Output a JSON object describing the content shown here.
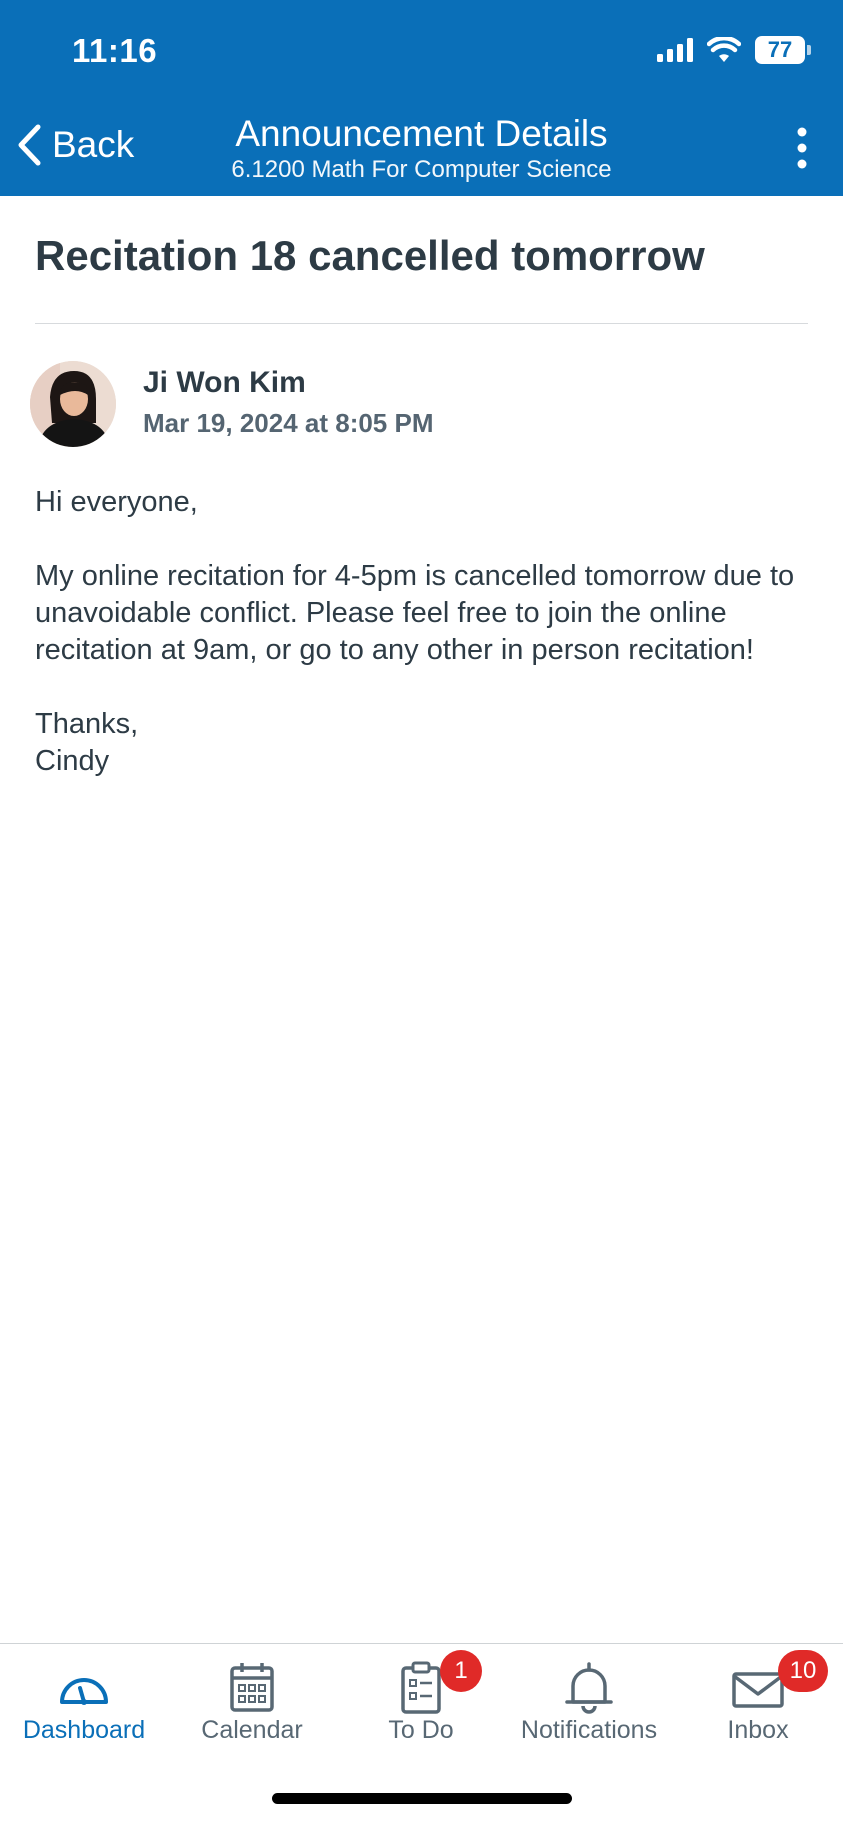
{
  "status_bar": {
    "time": "11:16",
    "battery": "77"
  },
  "nav": {
    "back_label": "Back",
    "title": "Announcement Details",
    "subtitle": "6.1200 Math For Computer Science"
  },
  "announcement": {
    "title": "Recitation 18 cancelled tomorrow",
    "author": "Ji Won Kim",
    "date": "Mar 19, 2024 at 8:05 PM",
    "body": [
      "Hi everyone,",
      "My online recitation for 4-5pm is cancelled tomorrow due to unavoidable conflict. Please feel free to join the online recitation at 9am, or go to any other in person recitation!"
    ],
    "signoff": [
      "Thanks,",
      "Cindy"
    ]
  },
  "tabbar": {
    "items": [
      {
        "label": "Dashboard",
        "icon": "dashboard-icon",
        "active": true
      },
      {
        "label": "Calendar",
        "icon": "calendar-icon"
      },
      {
        "label": "To Do",
        "icon": "todo-icon",
        "badge": "1"
      },
      {
        "label": "Notifications",
        "icon": "bell-icon"
      },
      {
        "label": "Inbox",
        "icon": "inbox-icon",
        "badge": "10"
      }
    ]
  },
  "colors": {
    "brand": "#0A6FB8",
    "badge": "#E02A28",
    "text": "#2D3B45"
  }
}
